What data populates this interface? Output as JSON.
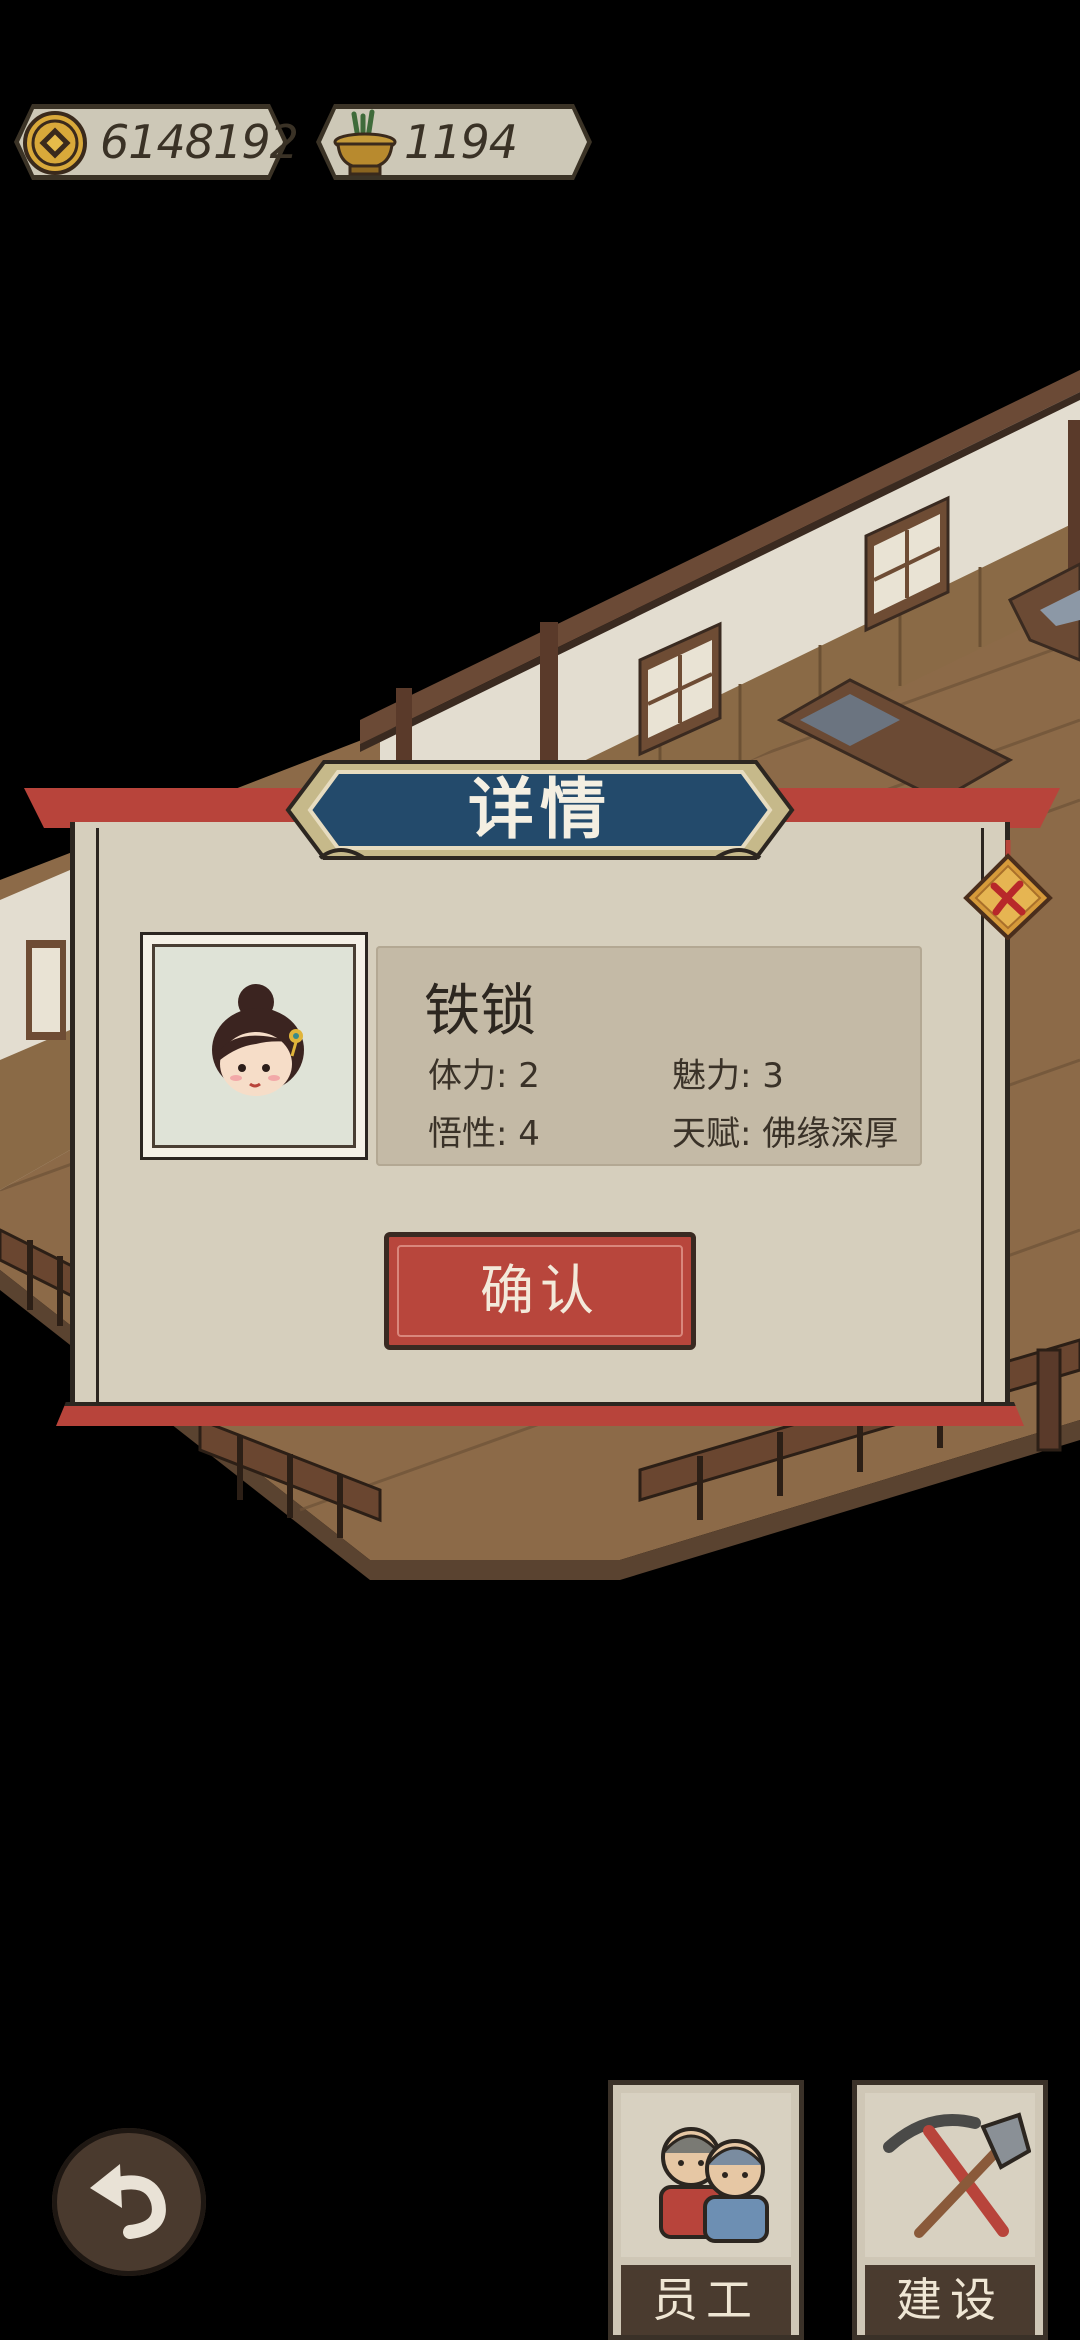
{
  "resources": {
    "coins": "6148192",
    "incense": "1194"
  },
  "dialog": {
    "title": "详情",
    "character": {
      "name": "铁锁",
      "stats": [
        {
          "label": "体力:",
          "value": "2"
        },
        {
          "label": "魅力:",
          "value": "3"
        },
        {
          "label": "悟性:",
          "value": "4"
        },
        {
          "label": "天赋:",
          "value": "佛缘深厚"
        }
      ]
    },
    "confirm_label": "确认"
  },
  "bottom_menu": {
    "staff_label": "员工",
    "build_label": "建设"
  },
  "colors": {
    "accent_red": "#b8443b",
    "title_blue": "#234a6b",
    "parchment": "#d6cfbd"
  }
}
